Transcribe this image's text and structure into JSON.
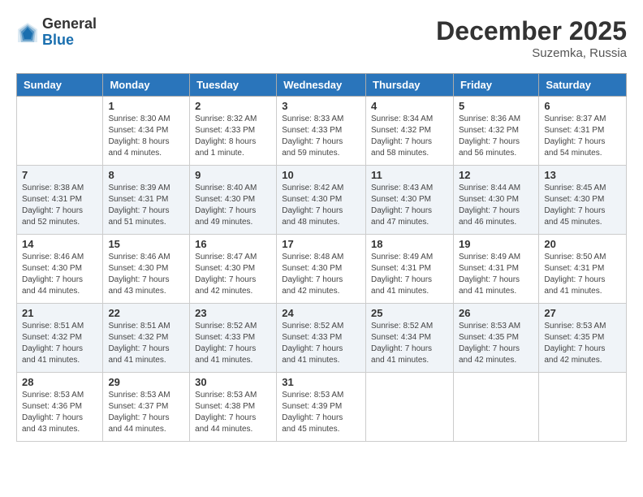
{
  "header": {
    "logo_general": "General",
    "logo_blue": "Blue",
    "month_title": "December 2025",
    "subtitle": "Suzemka, Russia"
  },
  "days_of_week": [
    "Sunday",
    "Monday",
    "Tuesday",
    "Wednesday",
    "Thursday",
    "Friday",
    "Saturday"
  ],
  "weeks": [
    [
      {
        "day": "",
        "info": ""
      },
      {
        "day": "1",
        "info": "Sunrise: 8:30 AM\nSunset: 4:34 PM\nDaylight: 8 hours\nand 4 minutes."
      },
      {
        "day": "2",
        "info": "Sunrise: 8:32 AM\nSunset: 4:33 PM\nDaylight: 8 hours\nand 1 minute."
      },
      {
        "day": "3",
        "info": "Sunrise: 8:33 AM\nSunset: 4:33 PM\nDaylight: 7 hours\nand 59 minutes."
      },
      {
        "day": "4",
        "info": "Sunrise: 8:34 AM\nSunset: 4:32 PM\nDaylight: 7 hours\nand 58 minutes."
      },
      {
        "day": "5",
        "info": "Sunrise: 8:36 AM\nSunset: 4:32 PM\nDaylight: 7 hours\nand 56 minutes."
      },
      {
        "day": "6",
        "info": "Sunrise: 8:37 AM\nSunset: 4:31 PM\nDaylight: 7 hours\nand 54 minutes."
      }
    ],
    [
      {
        "day": "7",
        "info": "Sunrise: 8:38 AM\nSunset: 4:31 PM\nDaylight: 7 hours\nand 52 minutes."
      },
      {
        "day": "8",
        "info": "Sunrise: 8:39 AM\nSunset: 4:31 PM\nDaylight: 7 hours\nand 51 minutes."
      },
      {
        "day": "9",
        "info": "Sunrise: 8:40 AM\nSunset: 4:30 PM\nDaylight: 7 hours\nand 49 minutes."
      },
      {
        "day": "10",
        "info": "Sunrise: 8:42 AM\nSunset: 4:30 PM\nDaylight: 7 hours\nand 48 minutes."
      },
      {
        "day": "11",
        "info": "Sunrise: 8:43 AM\nSunset: 4:30 PM\nDaylight: 7 hours\nand 47 minutes."
      },
      {
        "day": "12",
        "info": "Sunrise: 8:44 AM\nSunset: 4:30 PM\nDaylight: 7 hours\nand 46 minutes."
      },
      {
        "day": "13",
        "info": "Sunrise: 8:45 AM\nSunset: 4:30 PM\nDaylight: 7 hours\nand 45 minutes."
      }
    ],
    [
      {
        "day": "14",
        "info": "Sunrise: 8:46 AM\nSunset: 4:30 PM\nDaylight: 7 hours\nand 44 minutes."
      },
      {
        "day": "15",
        "info": "Sunrise: 8:46 AM\nSunset: 4:30 PM\nDaylight: 7 hours\nand 43 minutes."
      },
      {
        "day": "16",
        "info": "Sunrise: 8:47 AM\nSunset: 4:30 PM\nDaylight: 7 hours\nand 42 minutes."
      },
      {
        "day": "17",
        "info": "Sunrise: 8:48 AM\nSunset: 4:30 PM\nDaylight: 7 hours\nand 42 minutes."
      },
      {
        "day": "18",
        "info": "Sunrise: 8:49 AM\nSunset: 4:31 PM\nDaylight: 7 hours\nand 41 minutes."
      },
      {
        "day": "19",
        "info": "Sunrise: 8:49 AM\nSunset: 4:31 PM\nDaylight: 7 hours\nand 41 minutes."
      },
      {
        "day": "20",
        "info": "Sunrise: 8:50 AM\nSunset: 4:31 PM\nDaylight: 7 hours\nand 41 minutes."
      }
    ],
    [
      {
        "day": "21",
        "info": "Sunrise: 8:51 AM\nSunset: 4:32 PM\nDaylight: 7 hours\nand 41 minutes."
      },
      {
        "day": "22",
        "info": "Sunrise: 8:51 AM\nSunset: 4:32 PM\nDaylight: 7 hours\nand 41 minutes."
      },
      {
        "day": "23",
        "info": "Sunrise: 8:52 AM\nSunset: 4:33 PM\nDaylight: 7 hours\nand 41 minutes."
      },
      {
        "day": "24",
        "info": "Sunrise: 8:52 AM\nSunset: 4:33 PM\nDaylight: 7 hours\nand 41 minutes."
      },
      {
        "day": "25",
        "info": "Sunrise: 8:52 AM\nSunset: 4:34 PM\nDaylight: 7 hours\nand 41 minutes."
      },
      {
        "day": "26",
        "info": "Sunrise: 8:53 AM\nSunset: 4:35 PM\nDaylight: 7 hours\nand 42 minutes."
      },
      {
        "day": "27",
        "info": "Sunrise: 8:53 AM\nSunset: 4:35 PM\nDaylight: 7 hours\nand 42 minutes."
      }
    ],
    [
      {
        "day": "28",
        "info": "Sunrise: 8:53 AM\nSunset: 4:36 PM\nDaylight: 7 hours\nand 43 minutes."
      },
      {
        "day": "29",
        "info": "Sunrise: 8:53 AM\nSunset: 4:37 PM\nDaylight: 7 hours\nand 44 minutes."
      },
      {
        "day": "30",
        "info": "Sunrise: 8:53 AM\nSunset: 4:38 PM\nDaylight: 7 hours\nand 44 minutes."
      },
      {
        "day": "31",
        "info": "Sunrise: 8:53 AM\nSunset: 4:39 PM\nDaylight: 7 hours\nand 45 minutes."
      },
      {
        "day": "",
        "info": ""
      },
      {
        "day": "",
        "info": ""
      },
      {
        "day": "",
        "info": ""
      }
    ]
  ]
}
